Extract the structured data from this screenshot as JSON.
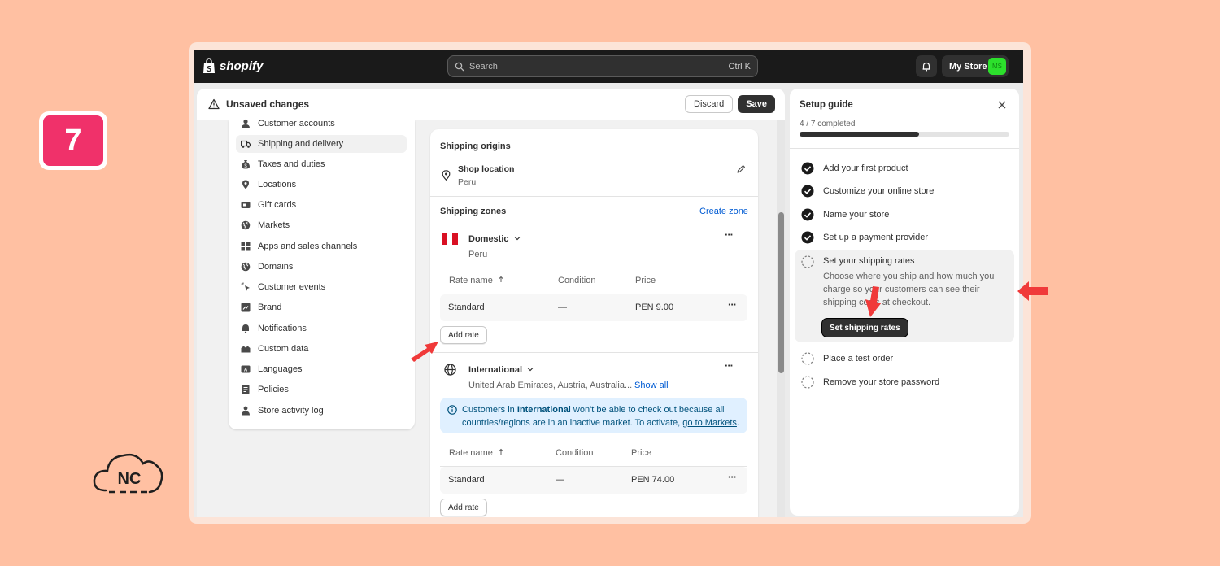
{
  "step_badge": {
    "number": "7"
  },
  "brand": {
    "nc_logo_text": "NC"
  },
  "topbar": {
    "logo_text": "shopify",
    "search_placeholder": "Search",
    "search_shortcut": "Ctrl K",
    "store_name": "My Store",
    "avatar_initials": "MS",
    "avatar_color": "#2CE02C"
  },
  "save_bar": {
    "title": "Unsaved changes",
    "discard_label": "Discard",
    "save_label": "Save"
  },
  "settings_nav": {
    "items": [
      {
        "label": "Customer accounts",
        "icon": "person-icon",
        "active": false
      },
      {
        "label": "Shipping and delivery",
        "icon": "truck-icon",
        "active": true
      },
      {
        "label": "Taxes and duties",
        "icon": "money-bag-icon",
        "active": false
      },
      {
        "label": "Locations",
        "icon": "location-pin-icon",
        "active": false
      },
      {
        "label": "Gift cards",
        "icon": "gift-card-icon",
        "active": false
      },
      {
        "label": "Markets",
        "icon": "globe-icon",
        "active": false
      },
      {
        "label": "Apps and sales channels",
        "icon": "apps-icon",
        "active": false
      },
      {
        "label": "Domains",
        "icon": "globe-icon",
        "active": false
      },
      {
        "label": "Customer events",
        "icon": "cursor-click-icon",
        "active": false
      },
      {
        "label": "Brand",
        "icon": "brand-icon",
        "active": false
      },
      {
        "label": "Notifications",
        "icon": "bell-icon",
        "active": false
      },
      {
        "label": "Custom data",
        "icon": "database-icon",
        "active": false
      },
      {
        "label": "Languages",
        "icon": "language-icon",
        "active": false
      },
      {
        "label": "Policies",
        "icon": "document-icon",
        "active": false
      },
      {
        "label": "Store activity log",
        "icon": "activity-log-icon",
        "active": false
      }
    ]
  },
  "shipping": {
    "origins_title": "Shipping origins",
    "origin_name": "Shop location",
    "origin_country": "Peru",
    "zones_title": "Shipping zones",
    "create_zone_label": "Create zone",
    "zones": [
      {
        "name": "Domestic",
        "countries": "Peru",
        "columns": [
          "Rate name",
          "Condition",
          "Price"
        ],
        "rates": [
          {
            "name": "Standard",
            "condition": "—",
            "price": "PEN 9.00"
          }
        ],
        "add_rate_label": "Add rate",
        "more_label": "···"
      },
      {
        "name": "International",
        "countries": "United Arab Emirates, Austria, Australia...",
        "show_all_label": "Show all",
        "info": {
          "prefix": "Customers in ",
          "bold": "International",
          "middle": " won't be able to check out because all countries/regions are in an inactive market. To activate, ",
          "link": "go to Markets",
          "suffix": "."
        },
        "columns": [
          "Rate name",
          "Condition",
          "Price"
        ],
        "rates": [
          {
            "name": "Standard",
            "condition": "—",
            "price": "PEN 74.00"
          }
        ],
        "add_rate_label": "Add rate",
        "more_label": "···"
      }
    ]
  },
  "setup_guide": {
    "title": "Setup guide",
    "progress_text": "4 / 7 completed",
    "progress": 0.57,
    "steps": [
      {
        "label": "Add your first product",
        "done": true
      },
      {
        "label": "Customize your online store",
        "done": true
      },
      {
        "label": "Name your store",
        "done": true
      },
      {
        "label": "Set up a payment provider",
        "done": true
      },
      {
        "label": "Set your shipping rates",
        "done": false,
        "active": true,
        "description": "Choose where you ship and how much you charge so your customers can see their shipping costs at checkout.",
        "button_label": "Set shipping rates"
      },
      {
        "label": "Place a test order",
        "done": false
      },
      {
        "label": "Remove your store password",
        "done": false
      }
    ]
  },
  "colors": {
    "background": "#FFC0A2",
    "badge": "#F0316A",
    "arrow": "#F03A3A",
    "flag_red": "#D91023"
  }
}
